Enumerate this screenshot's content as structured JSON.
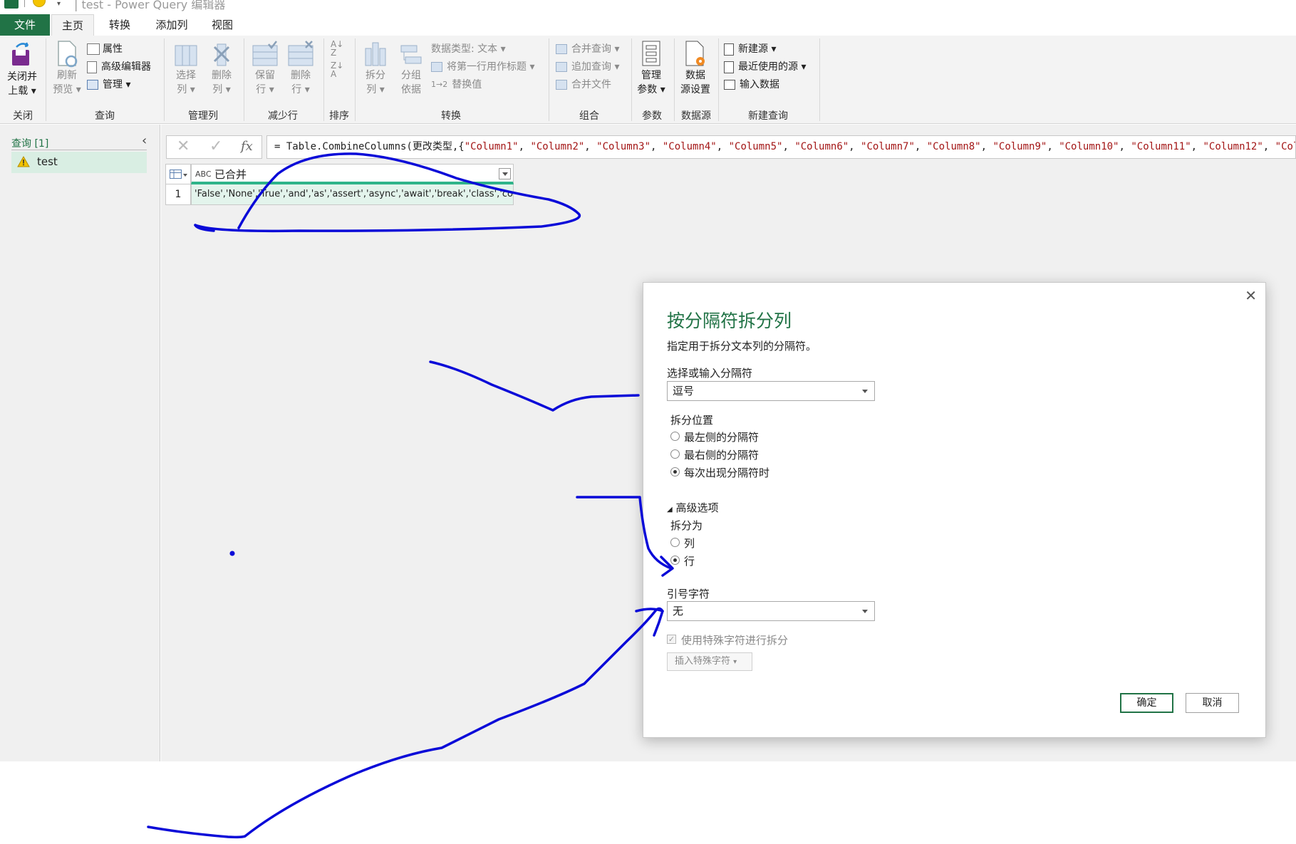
{
  "window": {
    "title": "| test - Power Query 编辑器"
  },
  "tabs": [
    {
      "label": "文件"
    },
    {
      "label": "主页"
    },
    {
      "label": "转换"
    },
    {
      "label": "添加列"
    },
    {
      "label": "视图"
    }
  ],
  "ribbon": {
    "close": {
      "line1": "关闭并",
      "line2": "上载",
      "group": "关闭"
    },
    "query": {
      "refresh_l1": "刷新",
      "refresh_l2": "预览",
      "properties": "属性",
      "advanced_editor": "高级编辑器",
      "manage": "管理",
      "group": "查询"
    },
    "manage_cols": {
      "choose_l1": "选择",
      "choose_l2": "列",
      "remove_l1": "删除",
      "remove_l2": "列",
      "group": "管理列"
    },
    "reduce_rows": {
      "keep_l1": "保留",
      "keep_l2": "行",
      "remove_l1": "删除",
      "remove_l2": "行",
      "group": "减少行"
    },
    "sort": {
      "group": "排序"
    },
    "transform": {
      "split_l1": "拆分",
      "split_l2": "列",
      "groupby_l1": "分组",
      "groupby_l2": "依据",
      "data_type": "数据类型: 文本",
      "first_row_header": "将第一行用作标题",
      "replace_values": "替换值",
      "group": "转换"
    },
    "combine": {
      "merge": "合并查询",
      "append": "追加查询",
      "combine_files": "合并文件",
      "group": "组合"
    },
    "params": {
      "l1": "管理",
      "l2": "参数",
      "group": "参数"
    },
    "datasource": {
      "l1": "数据",
      "l2": "源设置",
      "group": "数据源"
    },
    "newquery": {
      "new_source": "新建源",
      "recent_sources": "最近使用的源",
      "enter_data": "输入数据",
      "group": "新建查询"
    }
  },
  "left_pane": {
    "header": "查询 [1]",
    "items": [
      {
        "label": "test",
        "warning": true
      }
    ]
  },
  "formula": {
    "prefix": "= Table.CombineColumns(更改类型,{",
    "strings": [
      "\"Column1\"",
      "\"Column2\"",
      "\"Column3\"",
      "\"Column4\"",
      "\"Column5\"",
      "\"Column6\"",
      "\"Column7\"",
      "\"Column8\"",
      "\"Column9\"",
      "\"Column10\"",
      "\"Column11\"",
      "\"Column12\"",
      "\"Colum"
    ]
  },
  "grid": {
    "column_header": "已合并",
    "type_label": "ABC",
    "rows": [
      {
        "num": "1",
        "value": "'False','None','True','and','as','assert','async','await','break','class','cont..."
      }
    ]
  },
  "dialog": {
    "title": "按分隔符拆分列",
    "description": "指定用于拆分文本列的分隔符。",
    "delimiter_label": "选择或输入分隔符",
    "delimiter_value": "逗号",
    "split_at_label": "拆分位置",
    "split_at_options": [
      "最左侧的分隔符",
      "最右侧的分隔符",
      "每次出现分隔符时"
    ],
    "split_at_selected": 2,
    "advanced_label": "高级选项",
    "split_into_label": "拆分为",
    "split_into_options": [
      "列",
      "行"
    ],
    "split_into_selected": 1,
    "quote_label": "引号字符",
    "quote_value": "无",
    "special_chars_label": "使用特殊字符进行拆分",
    "special_chars_checked": true,
    "insert_special": "插入特殊字符",
    "ok": "确定",
    "cancel": "取消"
  },
  "colors": {
    "accent": "#217346",
    "dialog_title": "#217346",
    "ink": "#0a0ad8",
    "formula_string": "#a31515",
    "column_highlight": "#2fb48a"
  }
}
